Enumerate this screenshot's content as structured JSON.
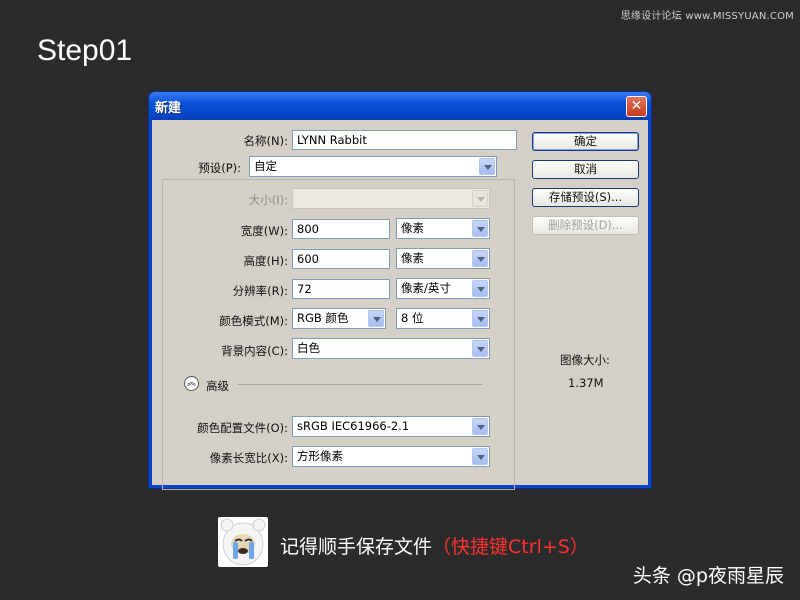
{
  "watermark": "思缘设计论坛 www.MISSYUAN.COM",
  "step_title": "Step01",
  "dialog": {
    "title": "新建",
    "close_glyph": "✕",
    "name": {
      "label": "名称(N):",
      "value": "LYNN Rabbit"
    },
    "preset": {
      "label": "预设(P):",
      "value": "自定"
    },
    "size": {
      "label": "大小(I):",
      "value": ""
    },
    "width": {
      "label": "宽度(W):",
      "value": "800",
      "unit": "像素"
    },
    "height": {
      "label": "高度(H):",
      "value": "600",
      "unit": "像素"
    },
    "resolution": {
      "label": "分辨率(R):",
      "value": "72",
      "unit": "像素/英寸"
    },
    "color_mode": {
      "label": "颜色模式(M):",
      "value": "RGB 颜色",
      "depth": "8 位"
    },
    "background": {
      "label": "背景内容(C):",
      "value": "白色"
    },
    "advanced": {
      "label": "高级",
      "toggle_glyph": "︽"
    },
    "color_profile": {
      "label": "颜色配置文件(O):",
      "value": "sRGB IEC61966-2.1"
    },
    "pixel_aspect": {
      "label": "像素长宽比(X):",
      "value": "方形像素"
    },
    "buttons": {
      "ok": "确定",
      "cancel": "取消",
      "save_preset": "存储预设(S)...",
      "delete_preset": "删除预设(D)..."
    },
    "image_size": {
      "label": "图像大小:",
      "value": "1.37M"
    }
  },
  "footer": {
    "reminder": "记得顺手保存文件",
    "shortcut": "（快捷键Ctrl+S）",
    "credit": "头条 @p夜雨星辰"
  },
  "colors": {
    "background": "#2b2b2b",
    "dialog_frame": "#0b46c8",
    "dialog_client": "#d4d0c8",
    "highlight_red": "#ff3030"
  }
}
